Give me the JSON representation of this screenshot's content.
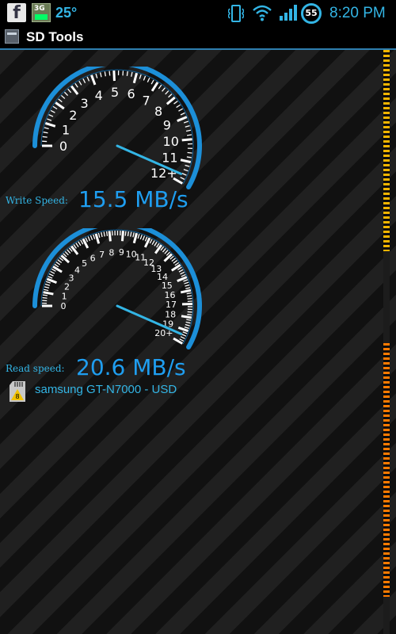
{
  "status_bar": {
    "facebook_icon": "facebook-icon",
    "network_badge": "3G",
    "temperature": "25°",
    "battery_level": "55",
    "time": "8:20 PM",
    "accent_color": "#33b5e5"
  },
  "title_bar": {
    "title": "SD Tools",
    "app_icon": "sd-tools-app-icon"
  },
  "write_test": {
    "label": "Write Speed:",
    "speed": "15.5 MB/s",
    "value": 15.5,
    "gauge_ticks": [
      "0",
      "1",
      "2",
      "3",
      "4",
      "5",
      "6",
      "7",
      "8",
      "9",
      "10",
      "11",
      "12+"
    ]
  },
  "read_test": {
    "label": "Read speed:",
    "speed": "20.6 MB/s",
    "value": 20.6,
    "gauge_ticks": [
      "0",
      "1",
      "2",
      "3",
      "4",
      "5",
      "6",
      "7",
      "8",
      "9",
      "10",
      "11",
      "12",
      "13",
      "14",
      "15",
      "16",
      "17",
      "18",
      "19",
      "20+"
    ]
  },
  "device": {
    "name": "samsung GT-N7000 - USD",
    "icon": "sd-card-icon"
  },
  "colors": {
    "gauge_ring": "#1c8fd8",
    "needle": "#33b5e5",
    "text_blue": "#1f9ef0"
  }
}
